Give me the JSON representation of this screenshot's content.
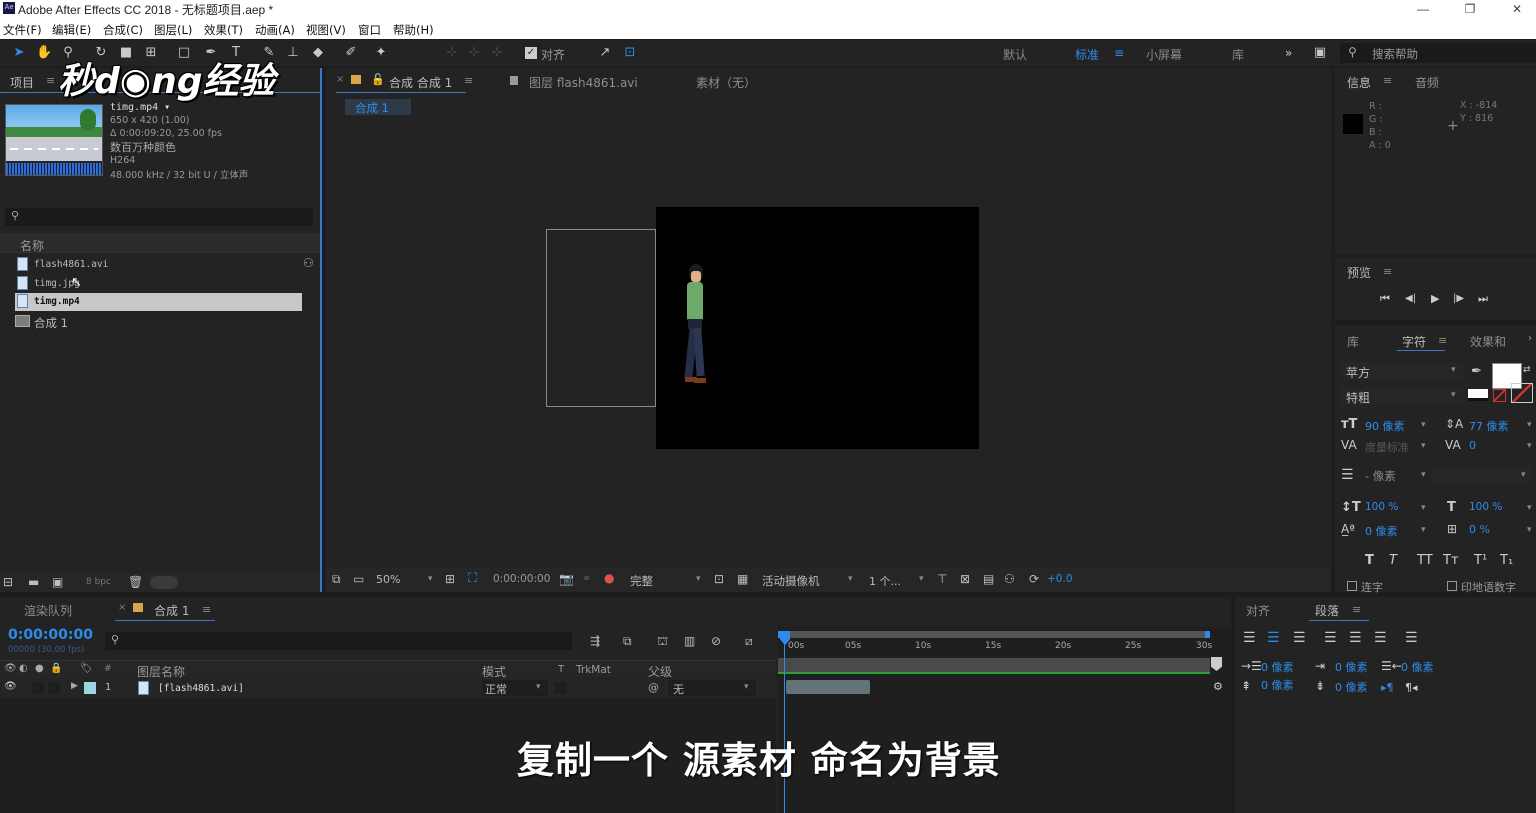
{
  "window": {
    "title": "Adobe After Effects CC 2018 - 无标题项目.aep *",
    "app_badge": "Ae",
    "minimize": "—",
    "restore": "❐",
    "close": "✕"
  },
  "menu": [
    "文件(F)",
    "编辑(E)",
    "合成(C)",
    "图层(L)",
    "效果(T)",
    "动画(A)",
    "视图(V)",
    "窗口",
    "帮助(H)"
  ],
  "toolbar": {
    "snap_label": "对齐",
    "workspaces": [
      "默认",
      "标准",
      "小屏幕",
      "库"
    ],
    "more": "»",
    "search_placeholder": "搜索帮助"
  },
  "watermark": "秒d◉ng经验",
  "project": {
    "tab": "项目",
    "item_name": "timg.mp4 ▾",
    "item_info": [
      "650 x 420 (1.00)",
      "Δ 0:00:09:20, 25.00 fps",
      "数百万种颜色",
      "H264",
      "48.000 kHz / 32 bit U / 立体声"
    ],
    "col_name": "名称",
    "files": [
      "flash4861.avi",
      "timg.jpg",
      "timg.mp4",
      "合成 1"
    ],
    "bpc": "8 bpc"
  },
  "comp_panel": {
    "tabs": [
      "合成 合成 1",
      "图层 flash4861.avi",
      "素材（无）"
    ],
    "breadcrumb": "合成 1",
    "zoom": "50%",
    "timecode": "0:00:00:00",
    "resolution": "完整",
    "camera": "活动摄像机",
    "views": "1 个...",
    "exposure": "+0.0"
  },
  "info": {
    "tabs": [
      "信息",
      "音频"
    ],
    "rgba": [
      "R :",
      "G :",
      "B :",
      "A : 0"
    ],
    "x": "X : -814",
    "y": "Y : 816"
  },
  "preview": {
    "tab": "预览",
    "controls": [
      "⏮",
      "◀|",
      "▶",
      "|▶",
      "⏭"
    ]
  },
  "character": {
    "tabs": [
      "库",
      "字符",
      "效果和"
    ],
    "font": "苹方",
    "style": "特粗",
    "size": "90 像素",
    "leading": "77 像素",
    "tracking_metric": "度量标准",
    "tracking_value": "0",
    "stroke": "- 像素",
    "vscale": "100 %",
    "hscale": "100 %",
    "baseline": "0 像素",
    "tsume": "0 %",
    "styles": [
      "T",
      "T",
      "TT",
      "Tт",
      "T¹",
      "T₁"
    ],
    "options": [
      "连字",
      "印地语数字"
    ]
  },
  "timeline": {
    "tabs": [
      "渲染队列",
      "合成 1"
    ],
    "timecode": "0:00:00:00",
    "fps": "00000 (30.00 fps)",
    "cols": [
      "图层名称",
      "模式",
      "T",
      "TrkMat",
      "父级"
    ],
    "layer_num": "1",
    "layer_name": "[flash4861.avi]",
    "layer_mode": "正常",
    "layer_parent": "无",
    "ruler": [
      "00s",
      "05s",
      "10s",
      "15s",
      "20s",
      "25s",
      "30s"
    ]
  },
  "paragraph": {
    "tabs": [
      "对齐",
      "段落"
    ],
    "indent": [
      "0 像素",
      "0 像素",
      "0 像素",
      "0 像素",
      "0 像素"
    ]
  },
  "subtitle": "复制一个 源素材 命名为背景"
}
